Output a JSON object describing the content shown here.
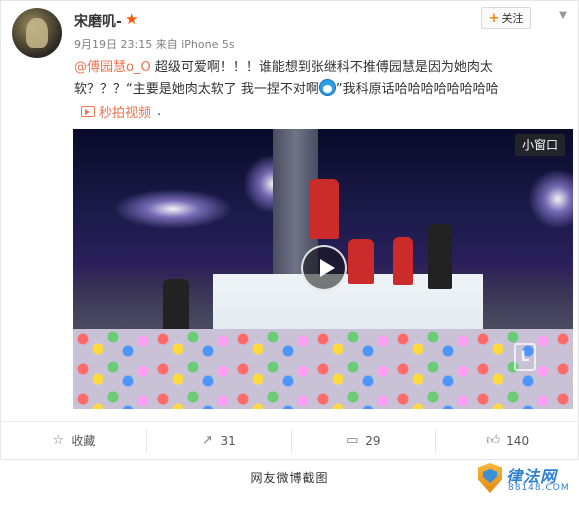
{
  "post": {
    "username": "宋磨叽-",
    "timestamp": "9月19日 23:15",
    "source_prefix": "来自",
    "source": "iPhone 5s",
    "follow_label": "关注",
    "content": {
      "mention": "@傅园慧o_O",
      "line1_after_mention": " 超级可爱啊！！！谁能想到张继科不推傅园慧是因为她肉太",
      "line2_before_emoji": "软？？？“主要是她肉太软了 我一捏不对啊",
      "line2_after_emoji": "”我科原话哈哈哈哈哈哈哈哈",
      "emoji": "doraemon-emoji"
    },
    "video_link": "秒拍视频",
    "video_link_trailing": ".",
    "video": {
      "small_window_label": "小窗口",
      "logo_glyph": "L"
    }
  },
  "actions": {
    "favorite_label": "收藏",
    "repost_count": "31",
    "comment_count": "29",
    "like_count": "140"
  },
  "caption": "网友微博截图",
  "watermark": {
    "brand": "律法网",
    "domain": "88148.COM"
  },
  "colors": {
    "mention": "#eb7350",
    "accent_orange": "#ff8200",
    "star": "#ff5500"
  },
  "icons": [
    "star-icon",
    "plus-icon",
    "chevron-down-icon",
    "video-icon",
    "play-icon",
    "favorite-icon",
    "repost-icon",
    "comment-icon",
    "like-icon"
  ]
}
